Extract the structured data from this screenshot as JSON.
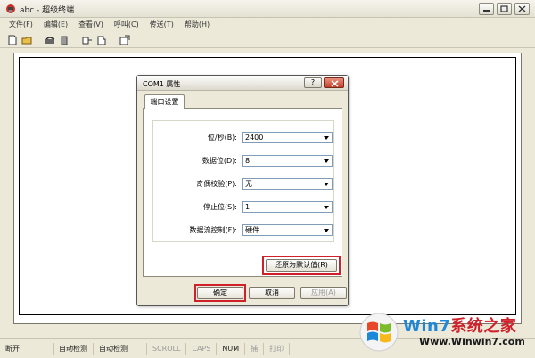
{
  "window": {
    "title": "abc - 超级终端"
  },
  "menu": [
    "文件(F)",
    "编辑(E)",
    "查看(V)",
    "呼叫(C)",
    "传送(T)",
    "帮助(H)"
  ],
  "dialog": {
    "title": "COM1 属性",
    "help_label": "?",
    "tab": "端口设置",
    "fields": [
      {
        "label": "位/秒(B):",
        "value": "2400"
      },
      {
        "label": "数据位(D):",
        "value": "8"
      },
      {
        "label": "奇偶校验(P):",
        "value": "无"
      },
      {
        "label": "停止位(S):",
        "value": "1"
      },
      {
        "label": "数据流控制(F):",
        "value": "硬件"
      }
    ],
    "restore_button": "还原为默认值(R)",
    "ok_button": "确定",
    "cancel_button": "取消",
    "apply_button": "应用(A)"
  },
  "status": {
    "connection": "断开",
    "detect1": "自动检测",
    "detect2": "自动检测",
    "scroll": "SCROLL",
    "caps": "CAPS",
    "num": "NUM",
    "capture": "捕",
    "print": "打印"
  },
  "watermark": {
    "brand_a": "Win7",
    "brand_b": "系统之家",
    "url": "Www.Winwin7.com"
  },
  "colors": {
    "highlight_red": "#d0202a",
    "close_red": "#c4402a"
  }
}
